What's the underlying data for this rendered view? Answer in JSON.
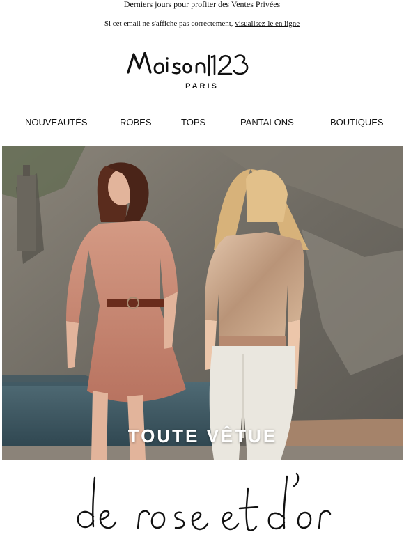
{
  "preheader": "Derniers jours pour profiter des Ventes Privées",
  "view_online": {
    "text": "Si cet email ne s'affiche pas correctement,",
    "link": "visualisez-le en ligne"
  },
  "brand": {
    "logo_text": "Maison 123",
    "city": "PARIS"
  },
  "nav": [
    {
      "label": "NOUVEAUTÉS"
    },
    {
      "label": "ROBES"
    },
    {
      "label": "TOPS"
    },
    {
      "label": "PANTALONS"
    },
    {
      "label": "BOUTIQUES"
    }
  ],
  "hero": {
    "caption": "TOUTE VÊTUE"
  },
  "script_tagline": "de rose et d'or",
  "colors": {
    "text": "#111111",
    "cliff": "#6d6a64",
    "dress_rose": "#c98872",
    "sequin_gold": "#c9a88a"
  }
}
